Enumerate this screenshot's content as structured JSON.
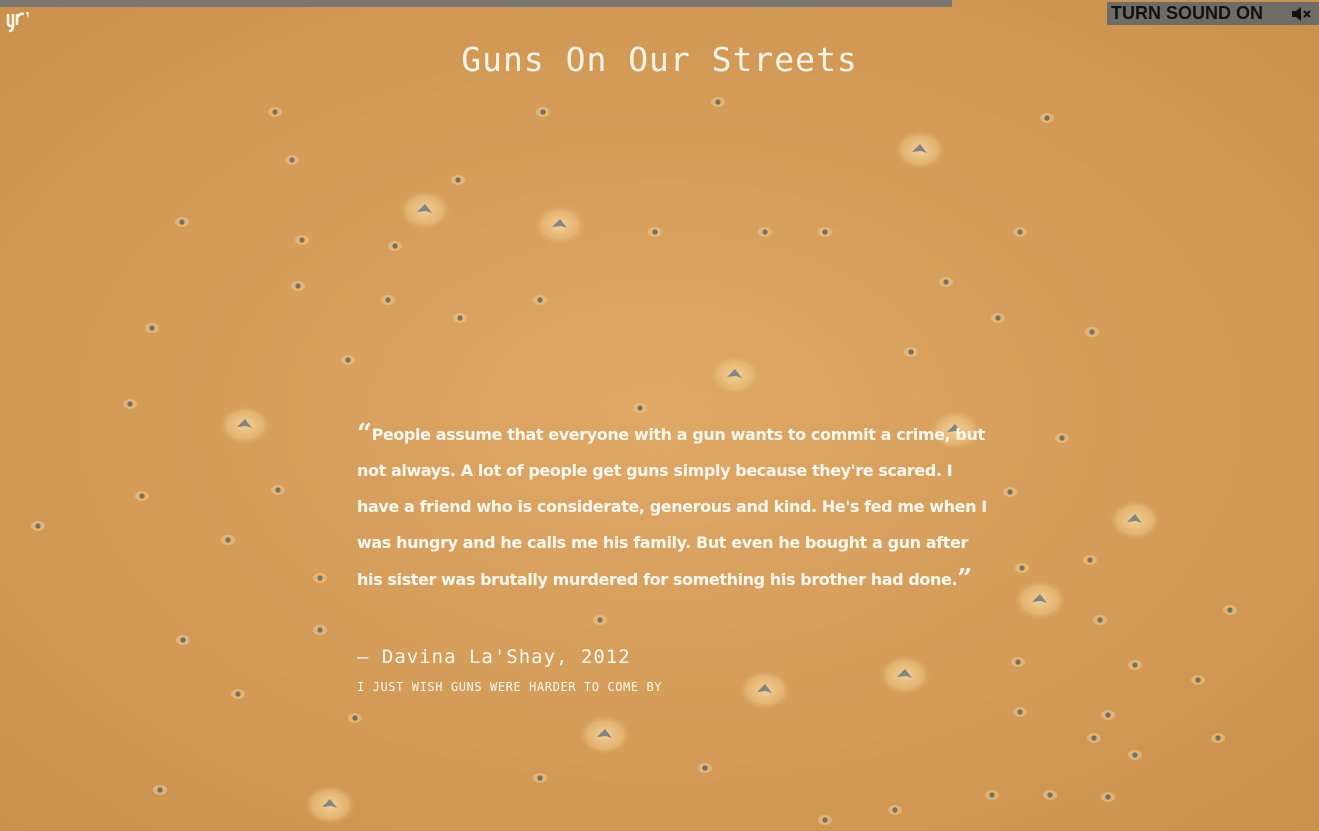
{
  "progress": {
    "fraction": 0.722,
    "fill_color": "#7c7770"
  },
  "logo": {
    "text": "yr",
    "icon": "yr-logo-icon"
  },
  "sound_toggle": {
    "label": "TURN SOUND ON",
    "icon": "speaker-muted-icon"
  },
  "title": "Guns On Our Streets",
  "quote": {
    "open_mark": "“",
    "text": "People assume that everyone with a gun wants to commit a crime, but not always. A lot of people get guns simply because they're scared. I have a friend who is considerate, generous and kind. He's fed me when I was hungry and he calls me his family. But even he bought a gun after his sister was brutally murdered for something his brother had done.",
    "close_mark": "”",
    "attribution": "— Davina La'Shay, 2012",
    "caption": "I JUST WISH GUNS WERE HARDER TO COME BY"
  },
  "colors": {
    "background": "#d9a25e",
    "text": "#fdf7ee",
    "sound_bg": "#6f6b66"
  }
}
